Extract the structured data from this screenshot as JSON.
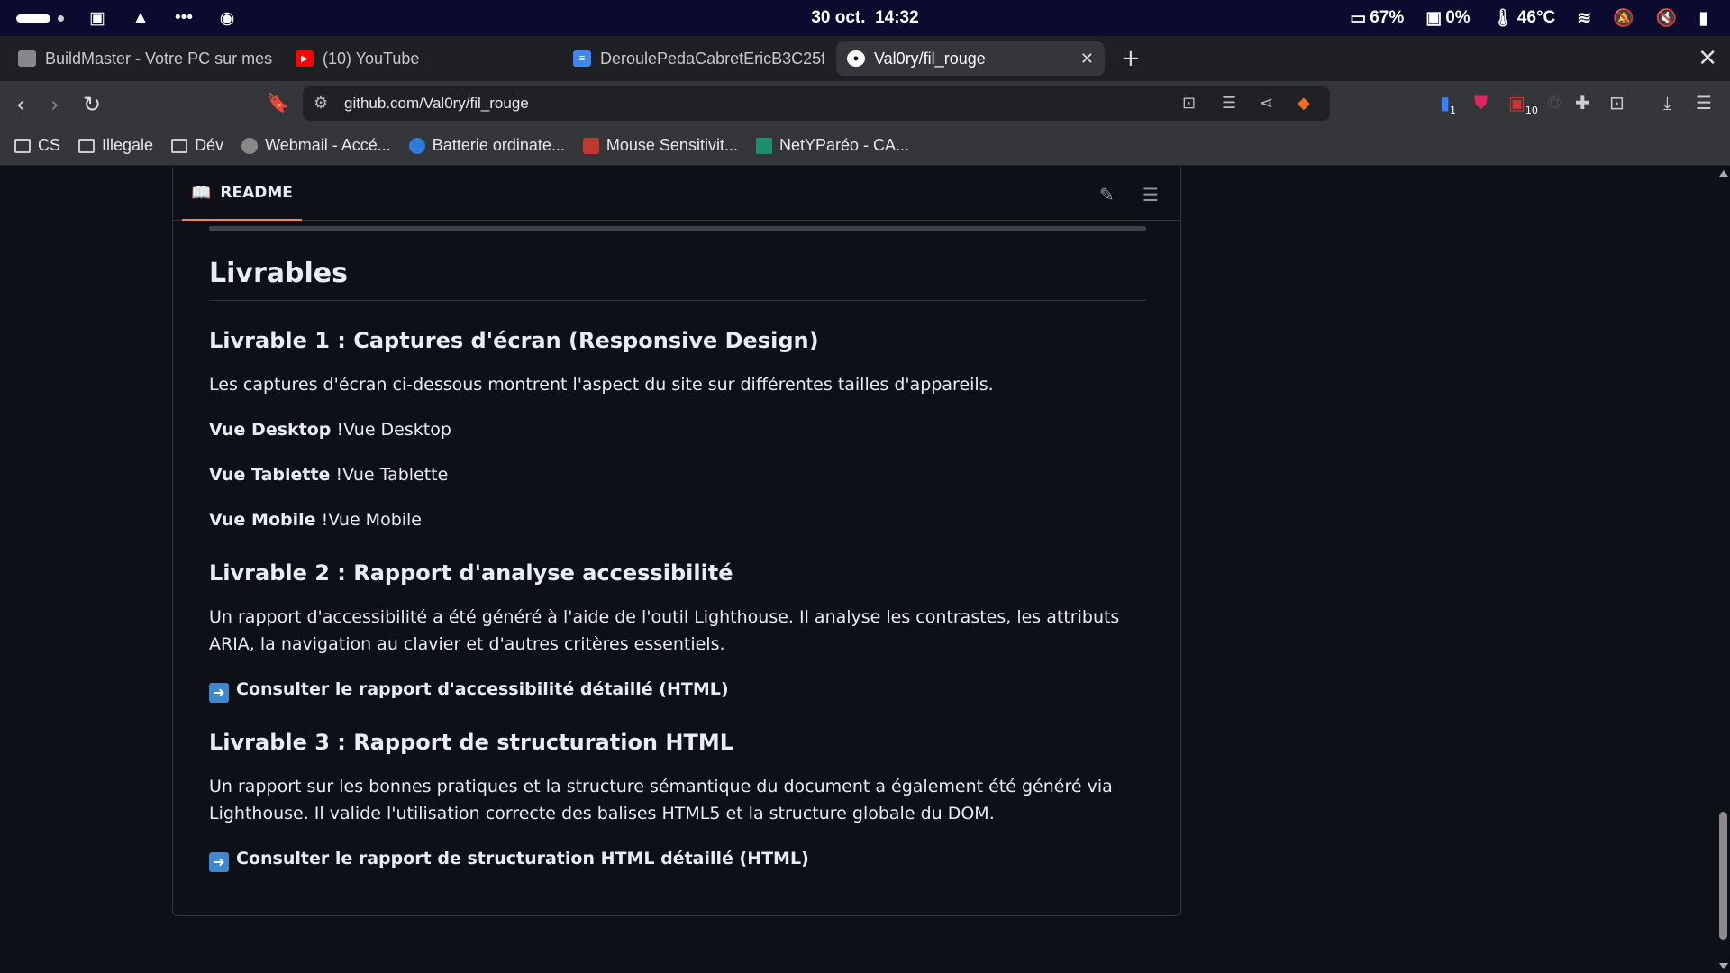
{
  "statusbar": {
    "date": "30 oct.",
    "time": "14:32",
    "battery_pct": "67%",
    "cpu_pct": "0%",
    "temperature": "46°C"
  },
  "tabs": [
    {
      "title": "BuildMaster - Votre PC sur mes",
      "icon": "monitor-icon"
    },
    {
      "title": "(10) YouTube",
      "icon": "youtube-icon"
    },
    {
      "title": "DeroulePedaCabretEricB3C25f",
      "icon": "docs-icon"
    },
    {
      "title": "Val0ry/fil_rouge",
      "icon": "github-icon",
      "active": true
    }
  ],
  "address": {
    "url": "github.com/Val0ry/fil_rouge"
  },
  "extensions": {
    "badge1": "1",
    "badge2": "10"
  },
  "bookmarks": [
    {
      "label": "CS",
      "icon": "folder-icon"
    },
    {
      "label": "Illegale",
      "icon": "folder-icon"
    },
    {
      "label": "Dév",
      "icon": "folder-icon"
    },
    {
      "label": "Webmail - Accé...",
      "icon": "globe-icon"
    },
    {
      "label": "Batterie ordinate...",
      "icon": "site-icon"
    },
    {
      "label": "Mouse Sensitivit...",
      "icon": "site-icon"
    },
    {
      "label": "NetYParéo - CA...",
      "icon": "site-icon"
    }
  ],
  "readme": {
    "tab_label": "README",
    "h2": "Livrables",
    "l1_title": "Livrable 1 : Captures d'écran (Responsive Design)",
    "l1_intro": "Les captures d'écran ci-dessous montrent l'aspect du site sur différentes tailles d'appareils.",
    "desktop_bold": "Vue Desktop",
    "desktop_alt": "!Vue Desktop",
    "tablet_bold": "Vue Tablette",
    "tablet_alt": "!Vue Tablette",
    "mobile_bold": "Vue Mobile",
    "mobile_alt": "!Vue Mobile",
    "l2_title": "Livrable 2 : Rapport d'analyse accessibilité",
    "l2_text": "Un rapport d'accessibilité a été généré à l'aide de l'outil Lighthouse. Il analyse les contrastes, les attributs ARIA, la navigation au clavier et d'autres critères essentiels.",
    "l2_link": "Consulter le rapport d'accessibilité détaillé (HTML)",
    "l3_title": "Livrable 3 : Rapport de structuration HTML",
    "l3_text": "Un rapport sur les bonnes pratiques et la structure sémantique du document a également été généré via Lighthouse. Il valide l'utilisation correcte des balises HTML5 et la structure globale du DOM.",
    "l3_link": "Consulter le rapport de structuration HTML détaillé (HTML)"
  },
  "colors": {
    "accent": "#f78166",
    "background": "#0d1117",
    "border": "#30363d"
  }
}
